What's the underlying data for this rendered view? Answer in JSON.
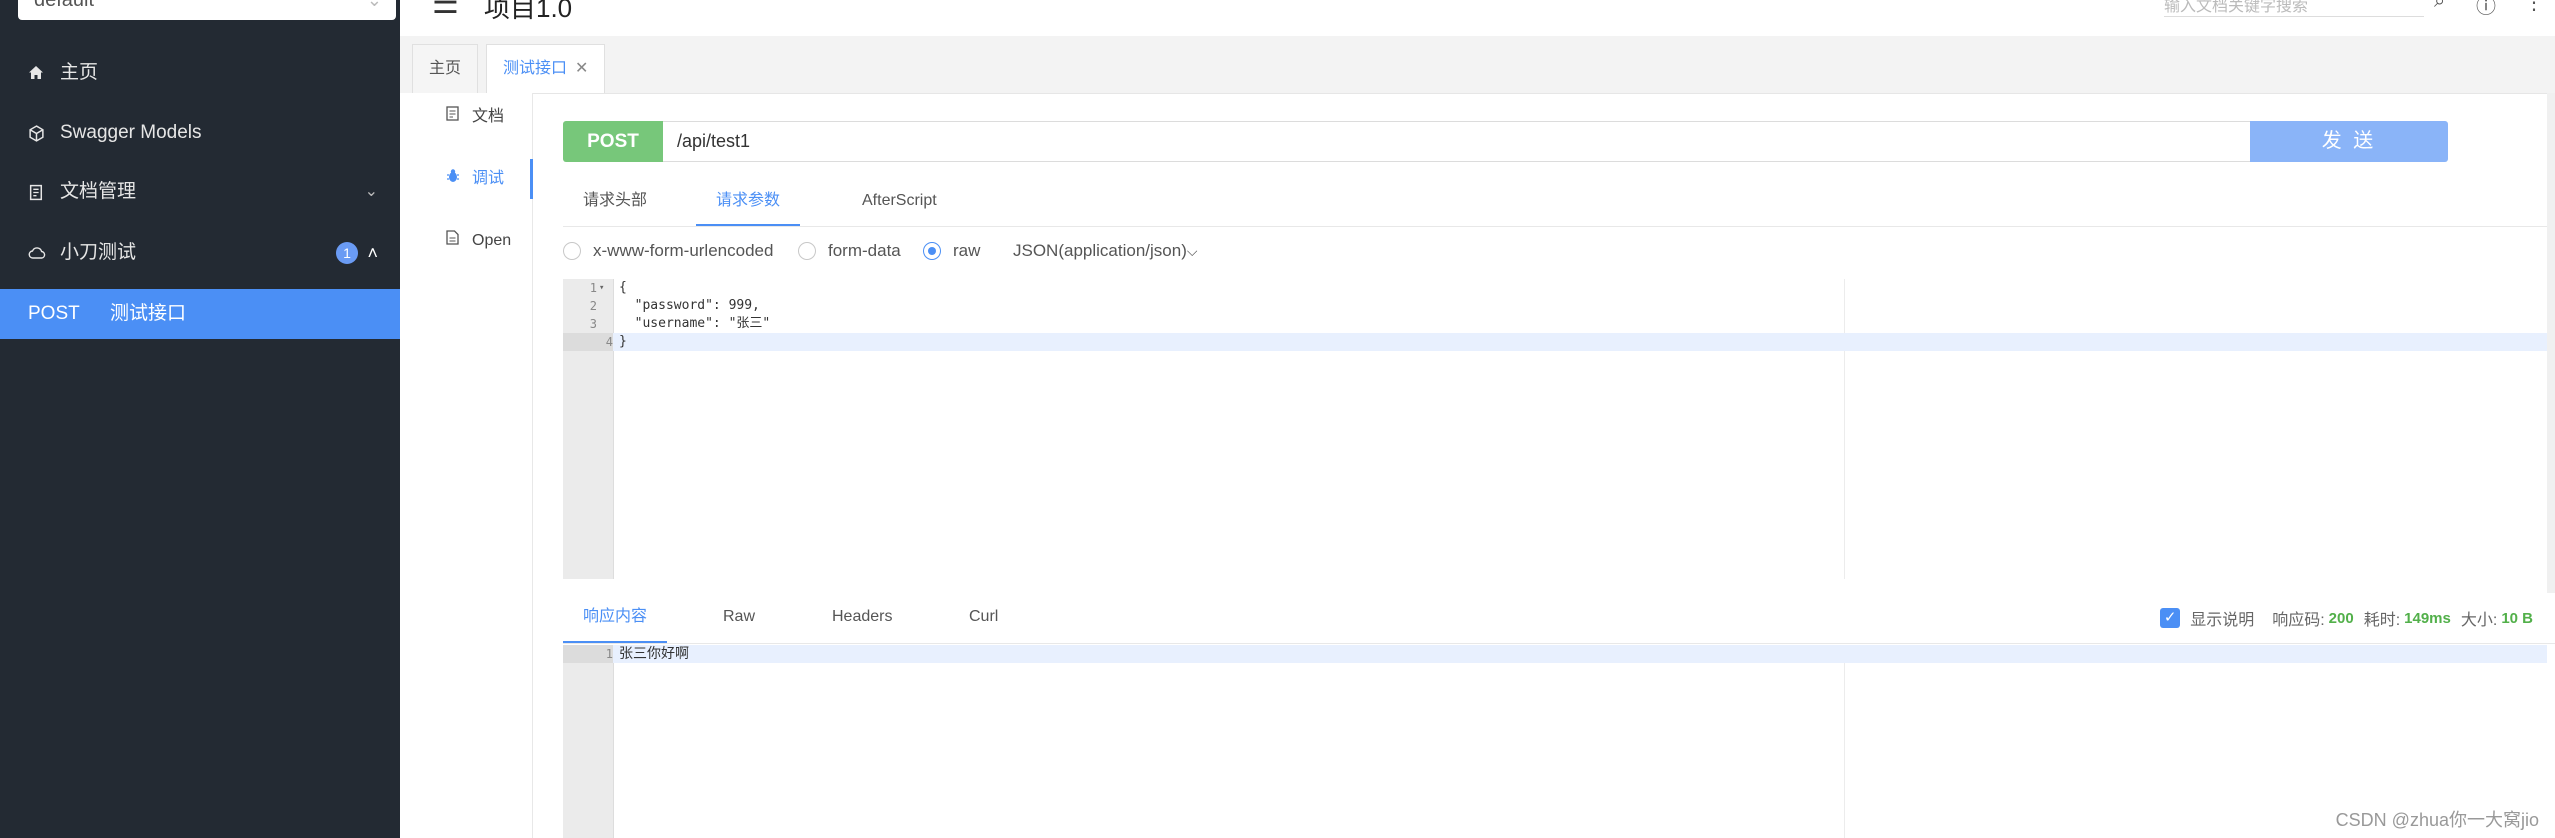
{
  "sidebar": {
    "group_select": "default",
    "items": [
      {
        "label": "主页"
      },
      {
        "label": "Swagger Models"
      },
      {
        "label": "文档管理"
      },
      {
        "label": "小刀测试",
        "badge": "1"
      }
    ],
    "active_item": {
      "method": "POST",
      "label": "测试接口"
    }
  },
  "header": {
    "title": "项目1.0",
    "search_placeholder": "输入文档关键字搜索"
  },
  "tabs": [
    {
      "label": "主页"
    },
    {
      "label": "测试接口"
    }
  ],
  "subnav": [
    {
      "label": "文档"
    },
    {
      "label": "调试"
    },
    {
      "label": "Open"
    }
  ],
  "request": {
    "method": "POST",
    "url": "/api/test1",
    "send_label": "发 送"
  },
  "param_tabs": [
    {
      "label": "请求头部"
    },
    {
      "label": "请求参数"
    },
    {
      "label": "AfterScript"
    }
  ],
  "body_types": [
    {
      "label": "x-www-form-urlencoded"
    },
    {
      "label": "form-data"
    },
    {
      "label": "raw"
    }
  ],
  "content_type": "JSON(application/json)",
  "request_body": {
    "line_numbers": [
      "1",
      "2",
      "3",
      "4"
    ],
    "lines": [
      "{",
      "  \"password\": 999,",
      "  \"username\": \"张三\"",
      "}"
    ]
  },
  "response_tabs": [
    {
      "label": "响应内容"
    },
    {
      "label": "Raw"
    },
    {
      "label": "Headers"
    },
    {
      "label": "Curl"
    }
  ],
  "response_info": {
    "show_desc_label": "显示说明",
    "code_label": "响应码:",
    "code": "200",
    "time_label": "耗时:",
    "time": "149ms",
    "size_label": "大小:",
    "size": "10 B"
  },
  "response_body": {
    "line_numbers": [
      "1"
    ],
    "lines": [
      "张三你好啊"
    ]
  },
  "watermark": "CSDN @zhua你一大窝jio",
  "colors": {
    "sidebar_bg": "#232a33",
    "accent": "#4b8ff5",
    "post_green": "#77c77a",
    "send_button": "#8ab4f8",
    "status_green": "#52b04a"
  }
}
